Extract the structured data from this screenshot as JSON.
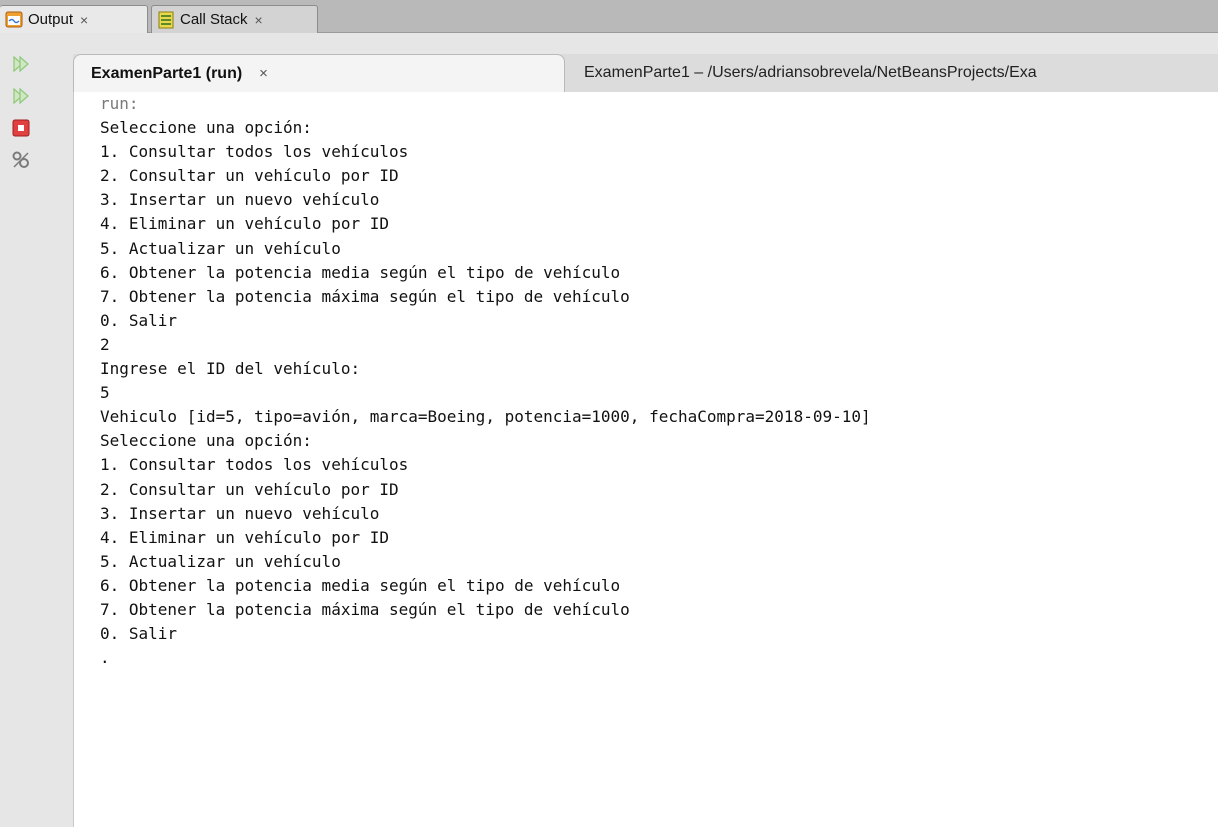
{
  "top_tabs": [
    {
      "label": "Output",
      "close": "×",
      "icon": "output-window-icon",
      "active": true
    },
    {
      "label": "Call Stack",
      "close": "×",
      "icon": "call-stack-icon",
      "active": false
    }
  ],
  "toolbar": {
    "icons": [
      "rerun-icon",
      "rerun-with-options-icon",
      "stop-icon",
      "settings-icon"
    ]
  },
  "session_tab": {
    "label": "ExamenParte1 (run)",
    "close": "×",
    "path": "ExamenParte1 – /Users/adriansobrevela/NetBeansProjects/Exa"
  },
  "console": {
    "lines": [
      "run:",
      "Seleccione una opción:",
      "1. Consultar todos los vehículos",
      "2. Consultar un vehículo por ID",
      "3. Insertar un nuevo vehículo",
      "4. Eliminar un vehículo por ID",
      "5. Actualizar un vehículo",
      "6. Obtener la potencia media según el tipo de vehículo",
      "7. Obtener la potencia máxima según el tipo de vehículo",
      "0. Salir",
      "2",
      "Ingrese el ID del vehículo:",
      "5",
      "Vehiculo [id=5, tipo=avión, marca=Boeing, potencia=1000, fechaCompra=2018-09-10]",
      "Seleccione una opción:",
      "1. Consultar todos los vehículos",
      "2. Consultar un vehículo por ID",
      "3. Insertar un nuevo vehículo",
      "4. Eliminar un vehículo por ID",
      "5. Actualizar un vehículo",
      "6. Obtener la potencia media según el tipo de vehículo",
      "7. Obtener la potencia máxima según el tipo de vehículo",
      "0. Salir",
      "."
    ]
  },
  "colors": {
    "rerun_green": "#8fc97a",
    "stop_red": "#e04040",
    "run_text": "#7a7a7a"
  }
}
